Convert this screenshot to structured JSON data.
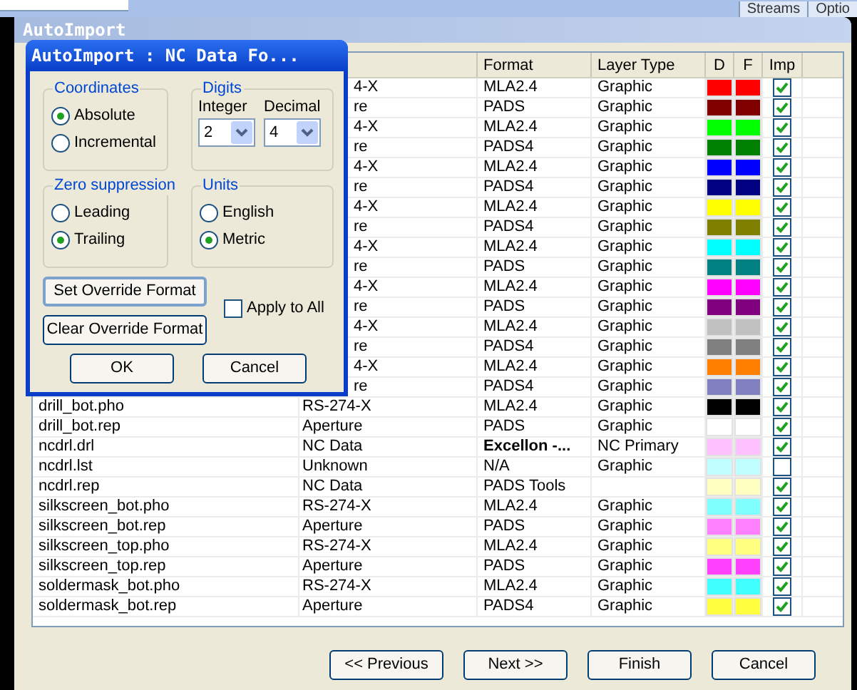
{
  "top_strip": {
    "tabs": [
      "Streams",
      "Optio"
    ]
  },
  "window": {
    "title": "AutoImport"
  },
  "table": {
    "columns": [
      "Format",
      "Layer Type",
      "D",
      "F",
      "Imp"
    ],
    "rows": [
      {
        "type": "4-X",
        "format": "MLA2.4",
        "layer_type": "Graphic",
        "color": "#ff0000",
        "imp": true
      },
      {
        "type": "re",
        "format": "PADS",
        "layer_type": "Graphic",
        "color": "#800000",
        "imp": true
      },
      {
        "type": "4-X",
        "format": "MLA2.4",
        "layer_type": "Graphic",
        "color": "#00ff00",
        "imp": true
      },
      {
        "type": "re",
        "format": "PADS4",
        "layer_type": "Graphic",
        "color": "#008000",
        "imp": true
      },
      {
        "type": "4-X",
        "format": "MLA2.4",
        "layer_type": "Graphic",
        "color": "#0000ff",
        "imp": true
      },
      {
        "type": "re",
        "format": "PADS4",
        "layer_type": "Graphic",
        "color": "#000080",
        "imp": true
      },
      {
        "type": "4-X",
        "format": "MLA2.4",
        "layer_type": "Graphic",
        "color": "#ffff00",
        "imp": true
      },
      {
        "type": "re",
        "format": "PADS4",
        "layer_type": "Graphic",
        "color": "#808000",
        "imp": true
      },
      {
        "type": "4-X",
        "format": "MLA2.4",
        "layer_type": "Graphic",
        "color": "#00ffff",
        "imp": true
      },
      {
        "type": "re",
        "format": "PADS",
        "layer_type": "Graphic",
        "color": "#008080",
        "imp": true
      },
      {
        "type": "4-X",
        "format": "MLA2.4",
        "layer_type": "Graphic",
        "color": "#ff00ff",
        "imp": true
      },
      {
        "type": "re",
        "format": "PADS",
        "layer_type": "Graphic",
        "color": "#800080",
        "imp": true
      },
      {
        "type": "4-X",
        "format": "MLA2.4",
        "layer_type": "Graphic",
        "color": "#c0c0c0",
        "imp": true
      },
      {
        "type": "re",
        "format": "PADS4",
        "layer_type": "Graphic",
        "color": "#808080",
        "imp": true
      },
      {
        "type": "4-X",
        "format": "MLA2.4",
        "layer_type": "Graphic",
        "color": "#ff8000",
        "imp": true
      },
      {
        "type": "re",
        "format": "PADS4",
        "layer_type": "Graphic",
        "color": "#8080c0",
        "imp": true
      },
      {
        "file": "drill_bot.pho",
        "type": "RS-274-X",
        "format": "MLA2.4",
        "layer_type": "Graphic",
        "color": "#000000",
        "imp": true
      },
      {
        "file": "drill_bot.rep",
        "type": "Aperture",
        "format": "PADS",
        "layer_type": "Graphic",
        "color": "#ffffff",
        "imp": true
      },
      {
        "file": "ncdrl.drl",
        "type": "NC Data",
        "format": "Excellon -...",
        "format_bold": true,
        "layer_type": "NC Primary",
        "color": "#ffc0ff",
        "imp": true
      },
      {
        "file": "ncdrl.lst",
        "type": "Unknown",
        "format": "N/A",
        "layer_type": "Graphic",
        "color": "#c0ffff",
        "imp": false
      },
      {
        "file": "ncdrl.rep",
        "type": "NC Data",
        "format": "PADS Tools",
        "color": "#ffffc0",
        "imp": true
      },
      {
        "file": "silkscreen_bot.pho",
        "type": "RS-274-X",
        "format": "MLA2.4",
        "layer_type": "Graphic",
        "color": "#80ffff",
        "imp": true
      },
      {
        "file": "silkscreen_bot.rep",
        "type": "Aperture",
        "format": "PADS",
        "layer_type": "Graphic",
        "color": "#ff80ff",
        "imp": true
      },
      {
        "file": "silkscreen_top.pho",
        "type": "RS-274-X",
        "format": "MLA2.4",
        "layer_type": "Graphic",
        "color": "#ffff80",
        "imp": true
      },
      {
        "file": "silkscreen_top.rep",
        "type": "Aperture",
        "format": "PADS",
        "layer_type": "Graphic",
        "color": "#ff40ff",
        "imp": true
      },
      {
        "file": "soldermask_bot.pho",
        "type": "RS-274-X",
        "format": "MLA2.4",
        "layer_type": "Graphic",
        "color": "#40ffff",
        "imp": true
      },
      {
        "file": "soldermask_bot.rep",
        "type": "Aperture",
        "format": "PADS4",
        "layer_type": "Graphic",
        "color": "#ffff40",
        "imp": true
      }
    ]
  },
  "dialog": {
    "title": "AutoImport : NC Data Fo...",
    "groups": [
      {
        "kind": "radio",
        "label": "Coordinates",
        "options": [
          {
            "label": "Absolute",
            "selected": true
          },
          {
            "label": "Incremental",
            "selected": false
          }
        ]
      },
      {
        "kind": "select",
        "label": "Digits",
        "fields": [
          {
            "label": "Integer",
            "value": "2"
          },
          {
            "label": "Decimal",
            "value": "4"
          }
        ]
      },
      {
        "kind": "radio",
        "label": "Zero suppression",
        "options": [
          {
            "label": "Leading",
            "selected": false
          },
          {
            "label": "Trailing",
            "selected": true
          }
        ]
      },
      {
        "kind": "radio",
        "label": "Units",
        "options": [
          {
            "label": "English",
            "selected": false
          },
          {
            "label": "Metric",
            "selected": true
          }
        ]
      }
    ],
    "override_buttons": [
      {
        "label": "Set Override Format",
        "focused": true
      },
      {
        "label": "Clear Override Format",
        "focused": false
      }
    ],
    "apply_to_all": {
      "label": "Apply to All",
      "checked": false
    },
    "buttons": [
      "OK",
      "Cancel"
    ]
  },
  "buttons": [
    "<< Previous",
    "Next >>",
    "Finish",
    "Cancel"
  ]
}
